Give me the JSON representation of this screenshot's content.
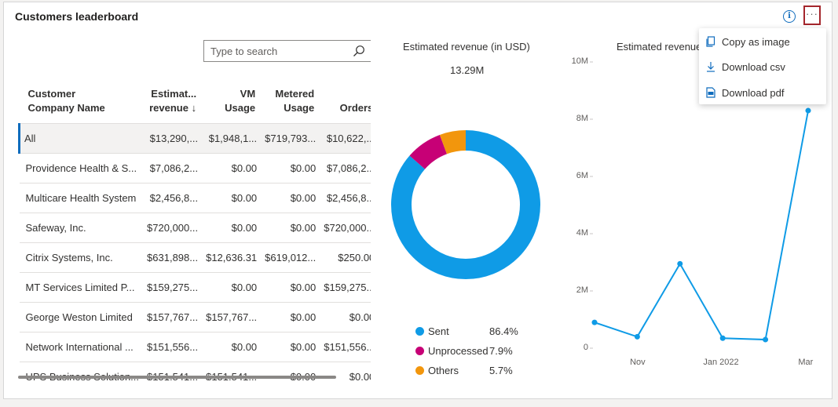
{
  "card": {
    "title": "Customers leaderboard"
  },
  "header": {
    "info_icon": "info-icon",
    "more_label": "···"
  },
  "search": {
    "placeholder": "Type to search"
  },
  "table": {
    "columns": [
      "Customer Company Name",
      "Estimat... revenue ↓",
      "VM Usage",
      "Metered Usage",
      "Orders"
    ],
    "rows": [
      [
        "All",
        "$13,290,...",
        "$1,948,1...",
        "$719,793...",
        "$10,622,..."
      ],
      [
        "Providence Health & S...",
        "$7,086,2...",
        "$0.00",
        "$0.00",
        "$7,086,2..."
      ],
      [
        "Multicare Health System",
        "$2,456,8...",
        "$0.00",
        "$0.00",
        "$2,456,8..."
      ],
      [
        "Safeway, Inc.",
        "$720,000...",
        "$0.00",
        "$0.00",
        "$720,000..."
      ],
      [
        "Citrix Systems, Inc.",
        "$631,898...",
        "$12,636.31",
        "$619,012...",
        "$250.00"
      ],
      [
        "MT Services Limited P...",
        "$159,275...",
        "$0.00",
        "$0.00",
        "$159,275..."
      ],
      [
        "George Weston Limited",
        "$157,767...",
        "$157,767...",
        "$0.00",
        "$0.00"
      ],
      [
        "Network International ...",
        "$151,556...",
        "$0.00",
        "$0.00",
        "$151,556..."
      ],
      [
        "UPS Business Solution...",
        "$151,541...",
        "$151,541...",
        "$0.00",
        "$0.00"
      ]
    ]
  },
  "donut": {
    "title": "Estimated revenue (in USD)",
    "total": "13.29M",
    "legend": [
      {
        "label": "Sent",
        "pct": "86.4%",
        "color": "#0f9be6"
      },
      {
        "label": "Unprocessed",
        "pct": "7.9%",
        "color": "#c70076"
      },
      {
        "label": "Others",
        "pct": "5.7%",
        "color": "#f2960d"
      }
    ]
  },
  "line_chart": {
    "title": "Estimated revenue",
    "y_ticks": [
      "10M",
      "8M",
      "6M",
      "4M",
      "2M",
      "0"
    ],
    "x_ticks": [
      "Nov",
      "Jan 2022",
      "Mar"
    ]
  },
  "chart_data": [
    {
      "type": "pie",
      "title": "Estimated revenue (in USD)",
      "total": "13.29M",
      "categories": [
        "Sent",
        "Unprocessed",
        "Others"
      ],
      "values": [
        86.4,
        7.9,
        5.7
      ],
      "colors": [
        "#0f9be6",
        "#c70076",
        "#f2960d"
      ],
      "legend": "bottom"
    },
    {
      "type": "line",
      "title": "Estimated revenue",
      "x": [
        "2021-10",
        "2021-11",
        "2021-12",
        "2022-01",
        "2022-02",
        "2022-03"
      ],
      "series": [
        {
          "values": [
            900000,
            400000,
            2950000,
            350000,
            300000,
            8300000
          ]
        }
      ],
      "ylim": [
        0,
        10000000
      ],
      "y_ticks": [
        "0",
        "2M",
        "4M",
        "6M",
        "8M",
        "10M"
      ],
      "x_ticks": [
        "Nov",
        "Jan 2022",
        "Mar"
      ],
      "color": "#0f9be6",
      "grid": false
    }
  ],
  "menu": {
    "items": [
      {
        "label": "Copy as image",
        "icon": "copy-icon"
      },
      {
        "label": "Download csv",
        "icon": "download-icon"
      },
      {
        "label": "Download pdf",
        "icon": "pdf-icon"
      }
    ]
  }
}
